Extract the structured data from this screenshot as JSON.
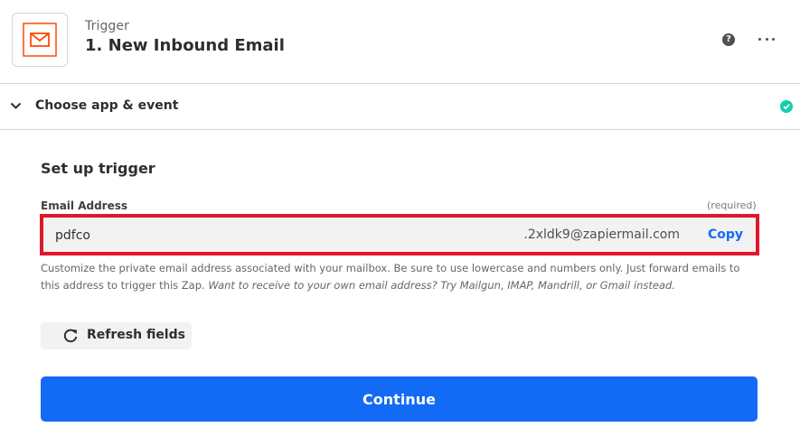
{
  "header": {
    "step_kind": "Trigger",
    "step_title": "1. New Inbound Email",
    "help_icon": "question-mark-circle",
    "more_icon": "ellipsis-horizontal",
    "app_icon": "envelope"
  },
  "section": {
    "label": "Choose app & event",
    "status": "complete"
  },
  "setup": {
    "title": "Set up trigger",
    "email_field": {
      "label": "Email Address",
      "required_text": "(required)",
      "value": "pdfco",
      "suffix": ".2xldk9@zapiermail.com",
      "copy_label": "Copy"
    },
    "help_text_plain": "Customize the private email address associated with your mailbox. Be sure to use lowercase and numbers only. Just forward emails to this address to trigger this Zap.",
    "help_text_italic": "Want to receive to your own email address? Try Mailgun, IMAP, Mandrill, or Gmail instead."
  },
  "buttons": {
    "refresh_label": "Refresh fields",
    "continue_label": "Continue"
  },
  "colors": {
    "accent": "#136bf5",
    "brand_orange": "#ff4a00",
    "highlight_border": "#e2152a",
    "success": "#13d0ab"
  }
}
